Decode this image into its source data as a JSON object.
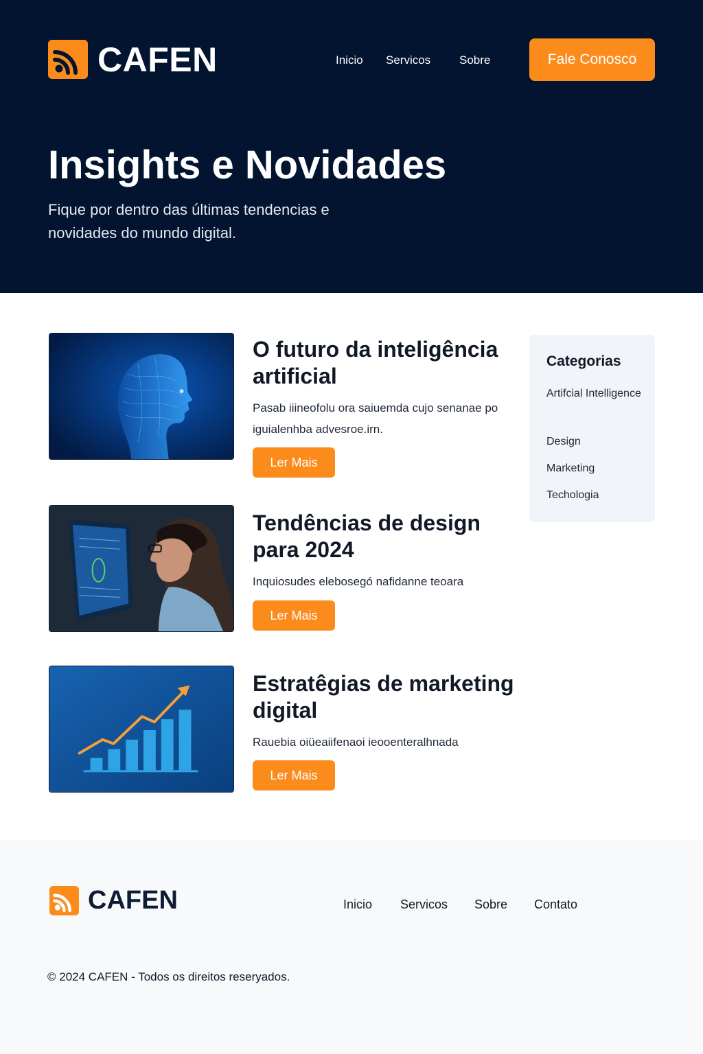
{
  "brand": {
    "name": "CAFEN",
    "icon": "rss-icon",
    "accent_color": "#fb8c1c",
    "dark_color": "#021430"
  },
  "nav": {
    "items": [
      "Inicio",
      "Servicos",
      "Sobre"
    ],
    "cta": "Fale Conosco"
  },
  "hero": {
    "title": "Insights e Novidades",
    "subtitle": "Fique por dentro das últimas tendencias e novidades do mundo digital."
  },
  "posts": [
    {
      "title": "O futuro da inteligência artificial",
      "excerpt": "Pasab iiineofolu ora saiuemda cujo senanae po iguialenhba advesroe.irn.",
      "button": "Ler Mais",
      "image": "ai-head-image"
    },
    {
      "title": "Tendências de design para 2024",
      "excerpt": "Inquiosudes elebosegó nafidanne teoara",
      "button": "Ler Mais",
      "image": "designer-at-monitor-image"
    },
    {
      "title": "Estratêgias de marketing digital",
      "excerpt": "Rauebia oiüeaiifenaoi ieooenteralhnada",
      "button": "Ler Mais",
      "image": "growth-chart-image"
    }
  ],
  "sidebar": {
    "title": "Categorias",
    "items": [
      "Artifcial Intelligence",
      "Design",
      "Marketing",
      "Techologia"
    ]
  },
  "footer": {
    "brand": "CAFEN",
    "links": [
      "Inicio",
      "Servicos",
      "Sobre",
      "Contato"
    ],
    "copyright": "© 2024 CAFEN - Todos os direitos reseryados."
  }
}
